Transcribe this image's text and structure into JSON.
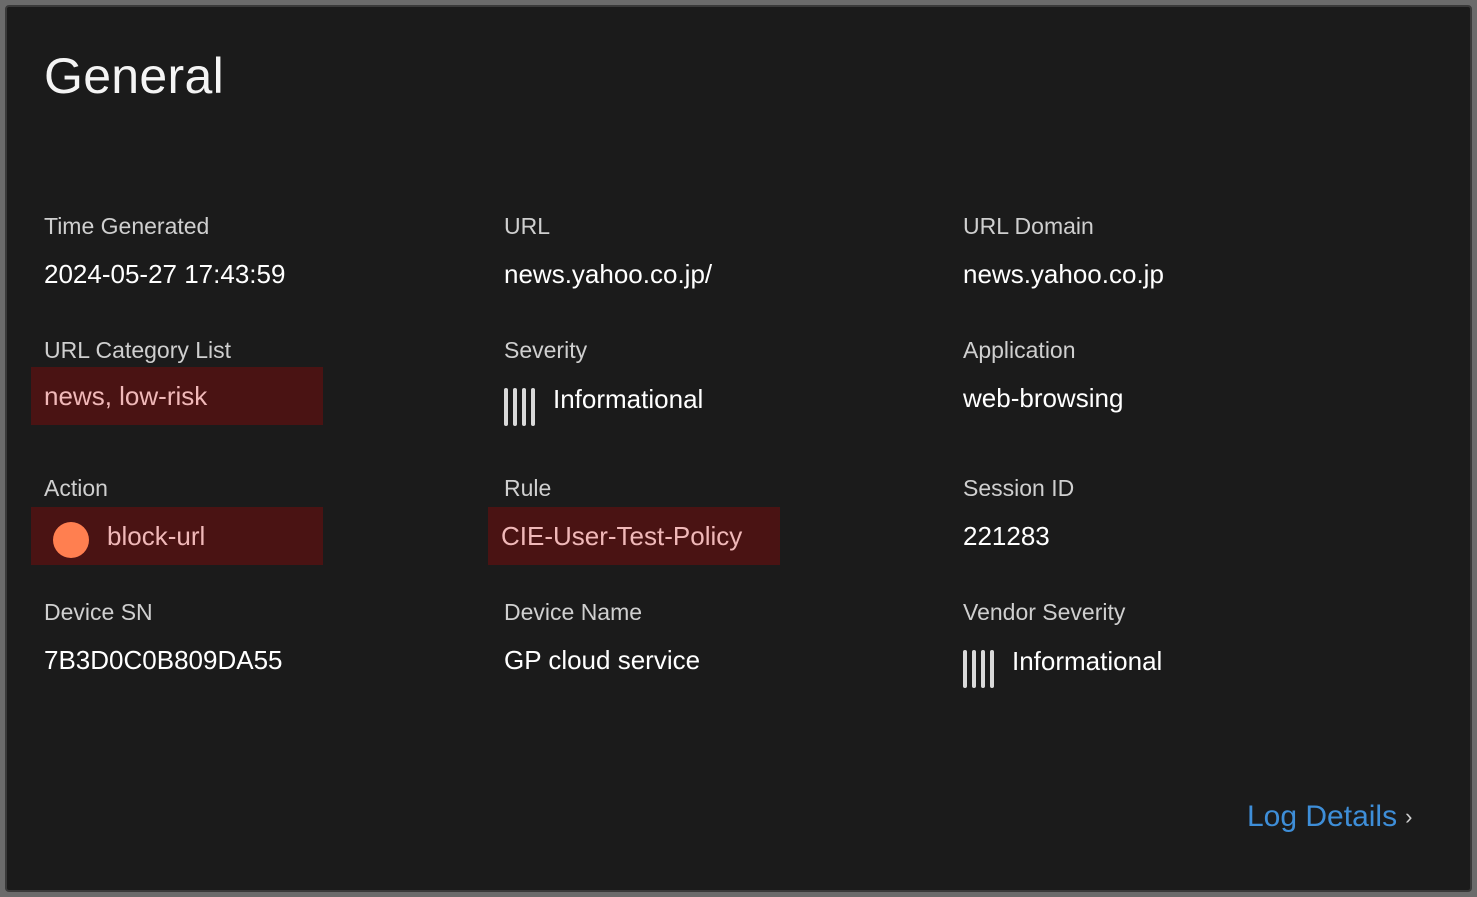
{
  "title": "General",
  "fields": {
    "time_generated": {
      "label": "Time Generated",
      "value": "2024-05-27 17:43:59"
    },
    "url": {
      "label": "URL",
      "value": "news.yahoo.co.jp/"
    },
    "url_domain": {
      "label": "URL Domain",
      "value": "news.yahoo.co.jp"
    },
    "url_category_list": {
      "label": "URL Category List",
      "value": "news, low-risk"
    },
    "severity": {
      "label": "Severity",
      "value": "Informational",
      "icon": "severity-bars-icon"
    },
    "application": {
      "label": "Application",
      "value": "web-browsing"
    },
    "action": {
      "label": "Action",
      "value": "block-url",
      "icon": "action-dot-icon"
    },
    "rule": {
      "label": "Rule",
      "value": "CIE-User-Test-Policy"
    },
    "session_id": {
      "label": "Session ID",
      "value": "221283"
    },
    "device_sn": {
      "label": "Device SN",
      "value": "7B3D0C0B809DA55"
    },
    "device_name": {
      "label": "Device Name",
      "value": "GP cloud service"
    },
    "vendor_severity": {
      "label": "Vendor Severity",
      "value": "Informational",
      "icon": "severity-bars-icon"
    }
  },
  "log_details": {
    "label": "Log Details",
    "icon": "chevron-right-icon"
  },
  "colors": {
    "background": "#1b1b1b",
    "highlight": "#4a1313",
    "link": "#3e8ed8",
    "action_dot": "#ff7f50"
  }
}
